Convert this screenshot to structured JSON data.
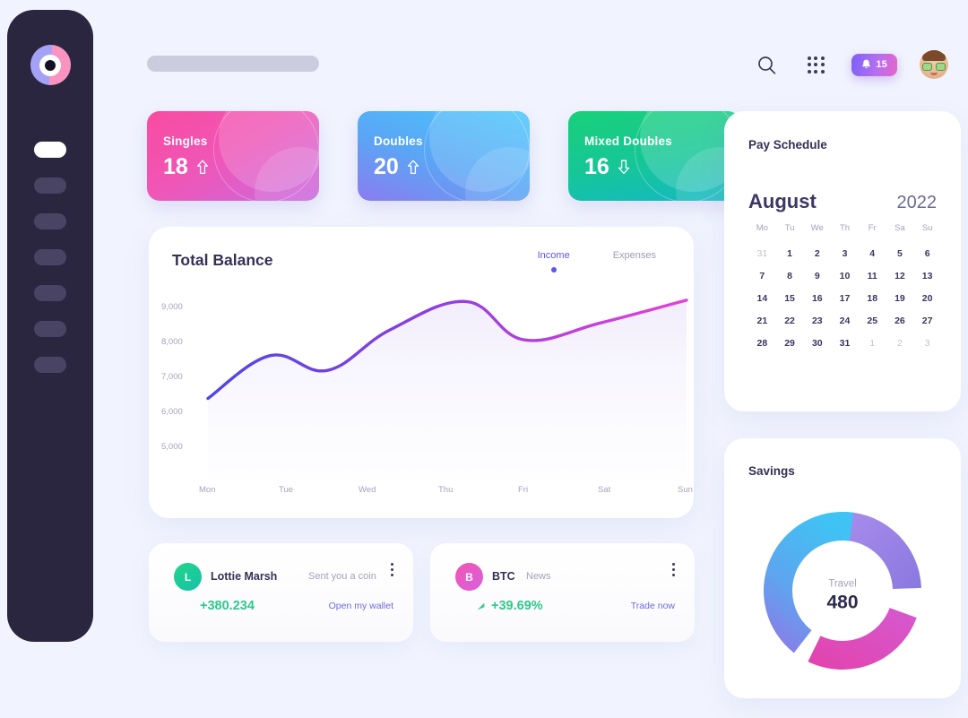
{
  "sidebar": {
    "logo_name": "app-logo",
    "items": [
      {
        "name": "nav-dashboard",
        "active": true
      },
      {
        "name": "nav-analytics",
        "active": false
      },
      {
        "name": "nav-wallet",
        "active": false
      },
      {
        "name": "nav-transactions",
        "active": false
      },
      {
        "name": "nav-cards",
        "active": false
      },
      {
        "name": "nav-reports",
        "active": false
      },
      {
        "name": "nav-settings",
        "active": false
      }
    ]
  },
  "header": {
    "search_placeholder": "",
    "search_value": "",
    "search_icon": "search-icon",
    "apps_icon": "grid-apps-icon",
    "notification_icon": "bell-icon",
    "notification_count": "15",
    "avatar_icon": "user-avatar"
  },
  "stats": [
    {
      "label": "Singles",
      "value": "18",
      "trend": "up",
      "theme": "pink"
    },
    {
      "label": "Doubles",
      "value": "20",
      "trend": "up",
      "theme": "blue"
    },
    {
      "label": "Mixed Doubles",
      "value": "16",
      "trend": "down",
      "theme": "green"
    }
  ],
  "balance": {
    "title": "Total Balance",
    "tabs": [
      {
        "label": "Income",
        "active": true
      },
      {
        "label": "Expenses",
        "active": false
      }
    ]
  },
  "transactions": [
    {
      "avatar_initial": "L",
      "avatar_theme": "green",
      "name": "Lottie Marsh",
      "subtitle": "Sent you a coin",
      "amount": "+380.234",
      "link": "Open my wallet",
      "has_trend_icon": false,
      "menu_icon": "more-vertical-icon"
    },
    {
      "avatar_initial": "B",
      "avatar_theme": "pink",
      "name": "BTC",
      "subtitle": "News",
      "amount": "+39.69%",
      "link": "Trade now",
      "has_trend_icon": true,
      "menu_icon": "more-vertical-icon"
    }
  ],
  "pay_schedule": {
    "title": "Pay Schedule",
    "month": "August",
    "year": "2022",
    "day_headers": [
      "Mo",
      "Tu",
      "We",
      "Th",
      "Fr",
      "Sa",
      "Su"
    ],
    "days": [
      {
        "n": "31",
        "mute": true
      },
      {
        "n": "1"
      },
      {
        "n": "2"
      },
      {
        "n": "3"
      },
      {
        "n": "4"
      },
      {
        "n": "5"
      },
      {
        "n": "6"
      },
      {
        "n": "7"
      },
      {
        "n": "8"
      },
      {
        "n": "9"
      },
      {
        "n": "10"
      },
      {
        "n": "11"
      },
      {
        "n": "12"
      },
      {
        "n": "13"
      },
      {
        "n": "14"
      },
      {
        "n": "15"
      },
      {
        "n": "16"
      },
      {
        "n": "17"
      },
      {
        "n": "18"
      },
      {
        "n": "19"
      },
      {
        "n": "20"
      },
      {
        "n": "21"
      },
      {
        "n": "22"
      },
      {
        "n": "23"
      },
      {
        "n": "24"
      },
      {
        "n": "25"
      },
      {
        "n": "26"
      },
      {
        "n": "27"
      },
      {
        "n": "28"
      },
      {
        "n": "29"
      },
      {
        "n": "30"
      },
      {
        "n": "31"
      },
      {
        "n": "1",
        "mute": true
      },
      {
        "n": "2",
        "mute": true
      },
      {
        "n": "3",
        "mute": true
      }
    ]
  },
  "savings": {
    "title": "Savings",
    "center_label": "Travel",
    "center_value": "480"
  },
  "colors": {
    "page_bg": "#f1f4fe",
    "sidebar_bg": "#2b2640",
    "accent_indigo": "#5b55e8",
    "accent_pink": "#e865c9",
    "positive_green": "#2ec98a",
    "text_dark": "#363056",
    "text_muted": "#a3a2bb"
  },
  "chart_data": {
    "type": "area",
    "title": "Total Balance",
    "xlabel": "",
    "ylabel": "",
    "ylim": [
      5000,
      9000
    ],
    "yticks": [
      5000,
      6000,
      7000,
      8000,
      9000
    ],
    "ytick_labels": [
      "5,000",
      "6,000",
      "7,000",
      "8,000",
      "9,000"
    ],
    "categories": [
      "Mon",
      "Tue",
      "Wed",
      "Thu",
      "Fri",
      "Sat",
      "Sun"
    ],
    "grid": false,
    "legend_position": "top-right",
    "series": [
      {
        "name": "Income",
        "values": [
          6400,
          7620,
          7200,
          8350,
          9160,
          8070,
          8550,
          9200
        ],
        "x_fraction": [
          0.0,
          0.13,
          0.25,
          0.38,
          0.54,
          0.66,
          0.82,
          1.0
        ],
        "color_start": "#4f46e5",
        "color_end": "#e640d8"
      }
    ]
  },
  "donut_data": {
    "type": "pie",
    "title": "Savings",
    "segments": [
      {
        "name": "purple-segment",
        "sweep_deg": 86,
        "color_start": "#9d84e8",
        "color_end": "#8a78e0"
      },
      {
        "name": "pink-segment",
        "sweep_deg": 96,
        "color_start": "#d956c4",
        "color_end": "#e04bb4"
      },
      {
        "name": "blue-segment",
        "sweep_deg": 150,
        "color_start": "#3fc3f4",
        "color_end": "#8f7ae8"
      }
    ]
  }
}
